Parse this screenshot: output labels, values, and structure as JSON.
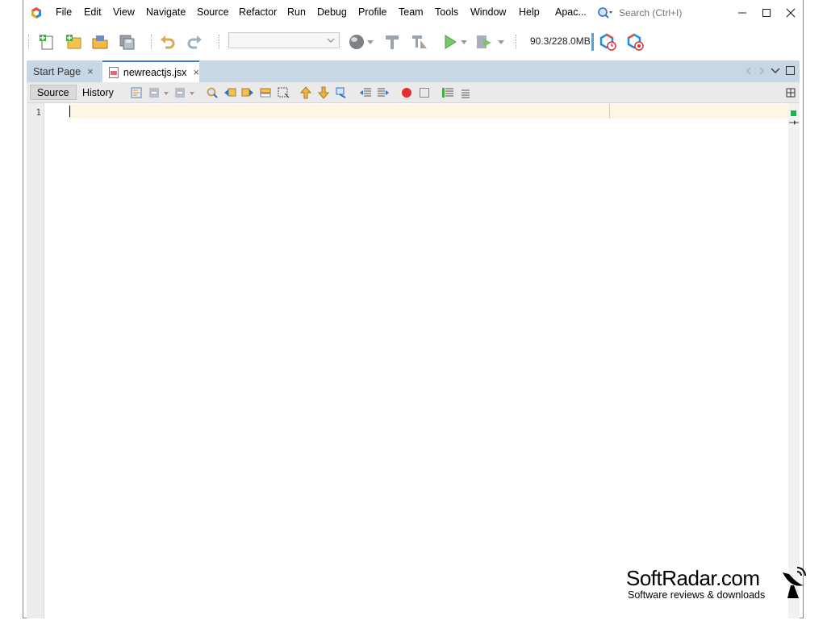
{
  "menu": {
    "items": [
      "File",
      "Edit",
      "View",
      "Navigate",
      "Source",
      "Refactor",
      "Run",
      "Debug",
      "Profile",
      "Team",
      "Tools",
      "Window",
      "Help",
      "Apac..."
    ]
  },
  "search": {
    "placeholder": "Search (Ctrl+I)"
  },
  "toolbar": {
    "memory": "90.3/228.0MB",
    "icons": [
      "new-file-icon",
      "new-project-icon",
      "open-project-icon",
      "save-all-icon",
      "undo-icon",
      "redo-icon",
      "config-combo",
      "globe-icon",
      "build-hammer-icon",
      "clean-build-icon",
      "run-icon",
      "debug-icon",
      "profile-icon",
      "profile-2-icon"
    ]
  },
  "tabs": [
    {
      "label": "Start Page",
      "active": false
    },
    {
      "label": "newreactjs.jsx",
      "active": true
    }
  ],
  "editor_toolbar": {
    "source_label": "Source",
    "history_label": "History"
  },
  "editor": {
    "line_numbers": [
      "1"
    ],
    "content": ""
  },
  "watermark": {
    "title": "SoftRadar.com",
    "subtitle": "Software reviews & downloads"
  },
  "colors": {
    "tab_bar": "#c8d7e6",
    "active_tab_accent": "#3a7bd5",
    "current_line": "#fdf6e3",
    "status_ok": "#20b050",
    "record": "#e03030"
  }
}
